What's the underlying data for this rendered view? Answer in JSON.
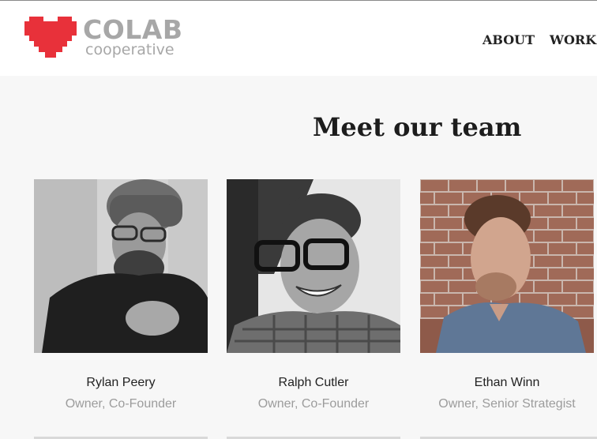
{
  "brand": {
    "name": "COLAB",
    "tagline": "cooperative",
    "logo_icon": "pixel-heart-icon",
    "heart_color": "#e8313a",
    "text_color": "#a7a7a7"
  },
  "nav": {
    "items": [
      {
        "label": "ABOUT"
      },
      {
        "label": "WORK"
      }
    ]
  },
  "team": {
    "heading": "Meet our team",
    "members": [
      {
        "name": "Rylan Peery",
        "role": "Owner, Co-Founder"
      },
      {
        "name": "Ralph Cutler",
        "role": "Owner, Co-Founder"
      },
      {
        "name": "Ethan Winn",
        "role": "Owner, Senior Strategist"
      }
    ]
  }
}
